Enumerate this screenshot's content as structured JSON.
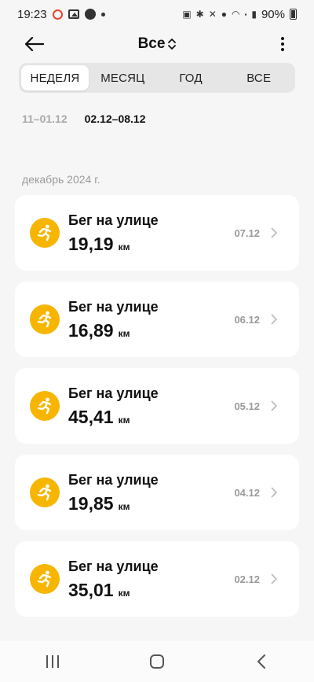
{
  "status_bar": {
    "time": "19:23",
    "battery": "90%",
    "left_icons": [
      "ring-icon",
      "gallery-icon",
      "mountain-icon",
      "dot-icon"
    ],
    "right_icons": [
      "nfc-icon",
      "bluetooth-icon",
      "mute-icon",
      "location-icon",
      "wifi-icon",
      "volte-icon",
      "signal-icon",
      "battery-icon"
    ]
  },
  "header": {
    "title": "Все"
  },
  "tabs": [
    {
      "label": "НЕДЕЛЯ",
      "active": true
    },
    {
      "label": "МЕСЯЦ",
      "active": false
    },
    {
      "label": "ГОД",
      "active": false
    },
    {
      "label": "ВСЕ",
      "active": false
    }
  ],
  "weeks": [
    {
      "label": "11–01.12",
      "active": false
    },
    {
      "label": "02.12–08.12",
      "active": true
    }
  ],
  "section_label": "декабрь 2024 г.",
  "workouts": [
    {
      "title": "Бег на улице",
      "distance": "19,19",
      "unit": "км",
      "date": "07.12"
    },
    {
      "title": "Бег на улице",
      "distance": "16,89",
      "unit": "км",
      "date": "06.12"
    },
    {
      "title": "Бег на улице",
      "distance": "45,41",
      "unit": "км",
      "date": "05.12"
    },
    {
      "title": "Бег на улице",
      "distance": "19,85",
      "unit": "км",
      "date": "04.12"
    },
    {
      "title": "Бег на улице",
      "distance": "35,01",
      "unit": "км",
      "date": "02.12"
    }
  ],
  "colors": {
    "accent": "#f7b500",
    "background": "#f6f6f6",
    "card": "#ffffff"
  }
}
